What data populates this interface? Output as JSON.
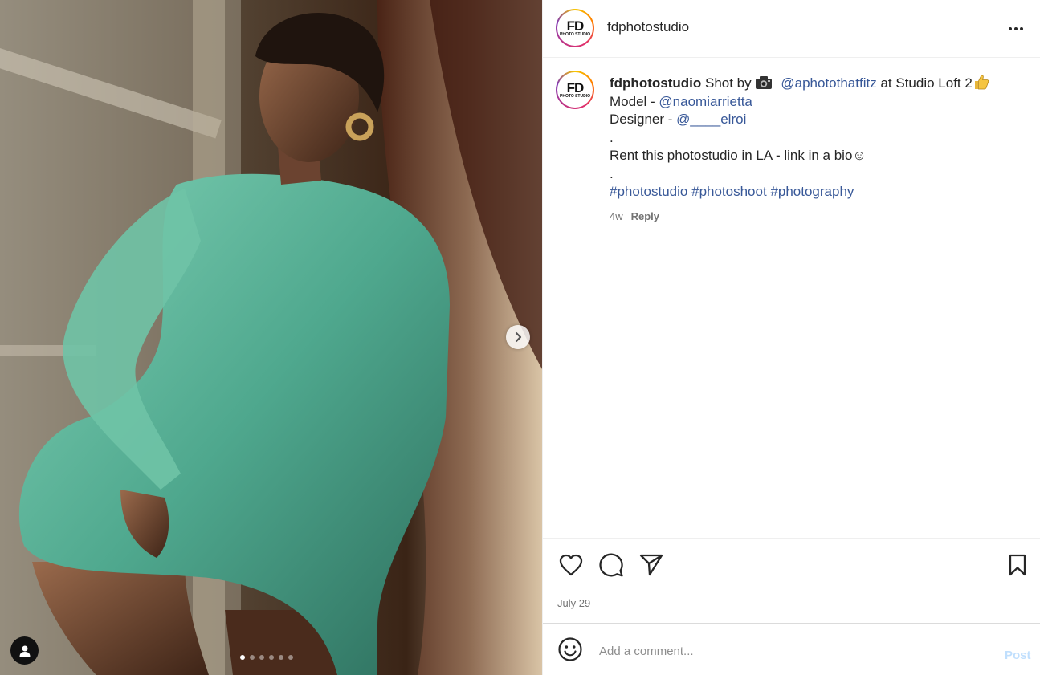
{
  "post": {
    "username": "fdphotostudio",
    "avatar_logo": "FD",
    "avatar_logo_sub": "PHOTO STUDIO",
    "caption": {
      "username": "fdphotostudio",
      "text_shot_by": "Shot by",
      "camera_icon": "camera-emoji",
      "photographer_link": "@aphotothatfitz",
      "text_location": "at Studio Loft 2",
      "thumbs_icon": "thumbs-up-emoji",
      "model_label": "Model -",
      "model_link": "@naomiarrietta",
      "designer_label": "Designer -",
      "designer_link": "@____elroi",
      "dot1": ".",
      "rent_text": "Rent this photostudio in LA - link in a bio☺",
      "dot2": ".",
      "hashtags": [
        "#photostudio",
        "#photoshoot",
        "#photography"
      ]
    },
    "age": "4w",
    "reply_label": "Reply",
    "date": "July 29"
  },
  "media": {
    "carousel_count": 6,
    "carousel_active": 1,
    "next_icon": "chevron-right-icon",
    "tag_icon": "user-tag-icon"
  },
  "actions": {
    "like_icon": "heart-icon",
    "comment_icon": "comment-bubble-icon",
    "share_icon": "paper-plane-icon",
    "save_icon": "bookmark-icon"
  },
  "comment": {
    "placeholder": "Add a comment...",
    "post_label": "Post",
    "emoji_icon": "smiley-icon"
  },
  "colors": {
    "link": "#385898",
    "post_button_disabled": "#c0dffd",
    "dress": "#4fa88e"
  }
}
